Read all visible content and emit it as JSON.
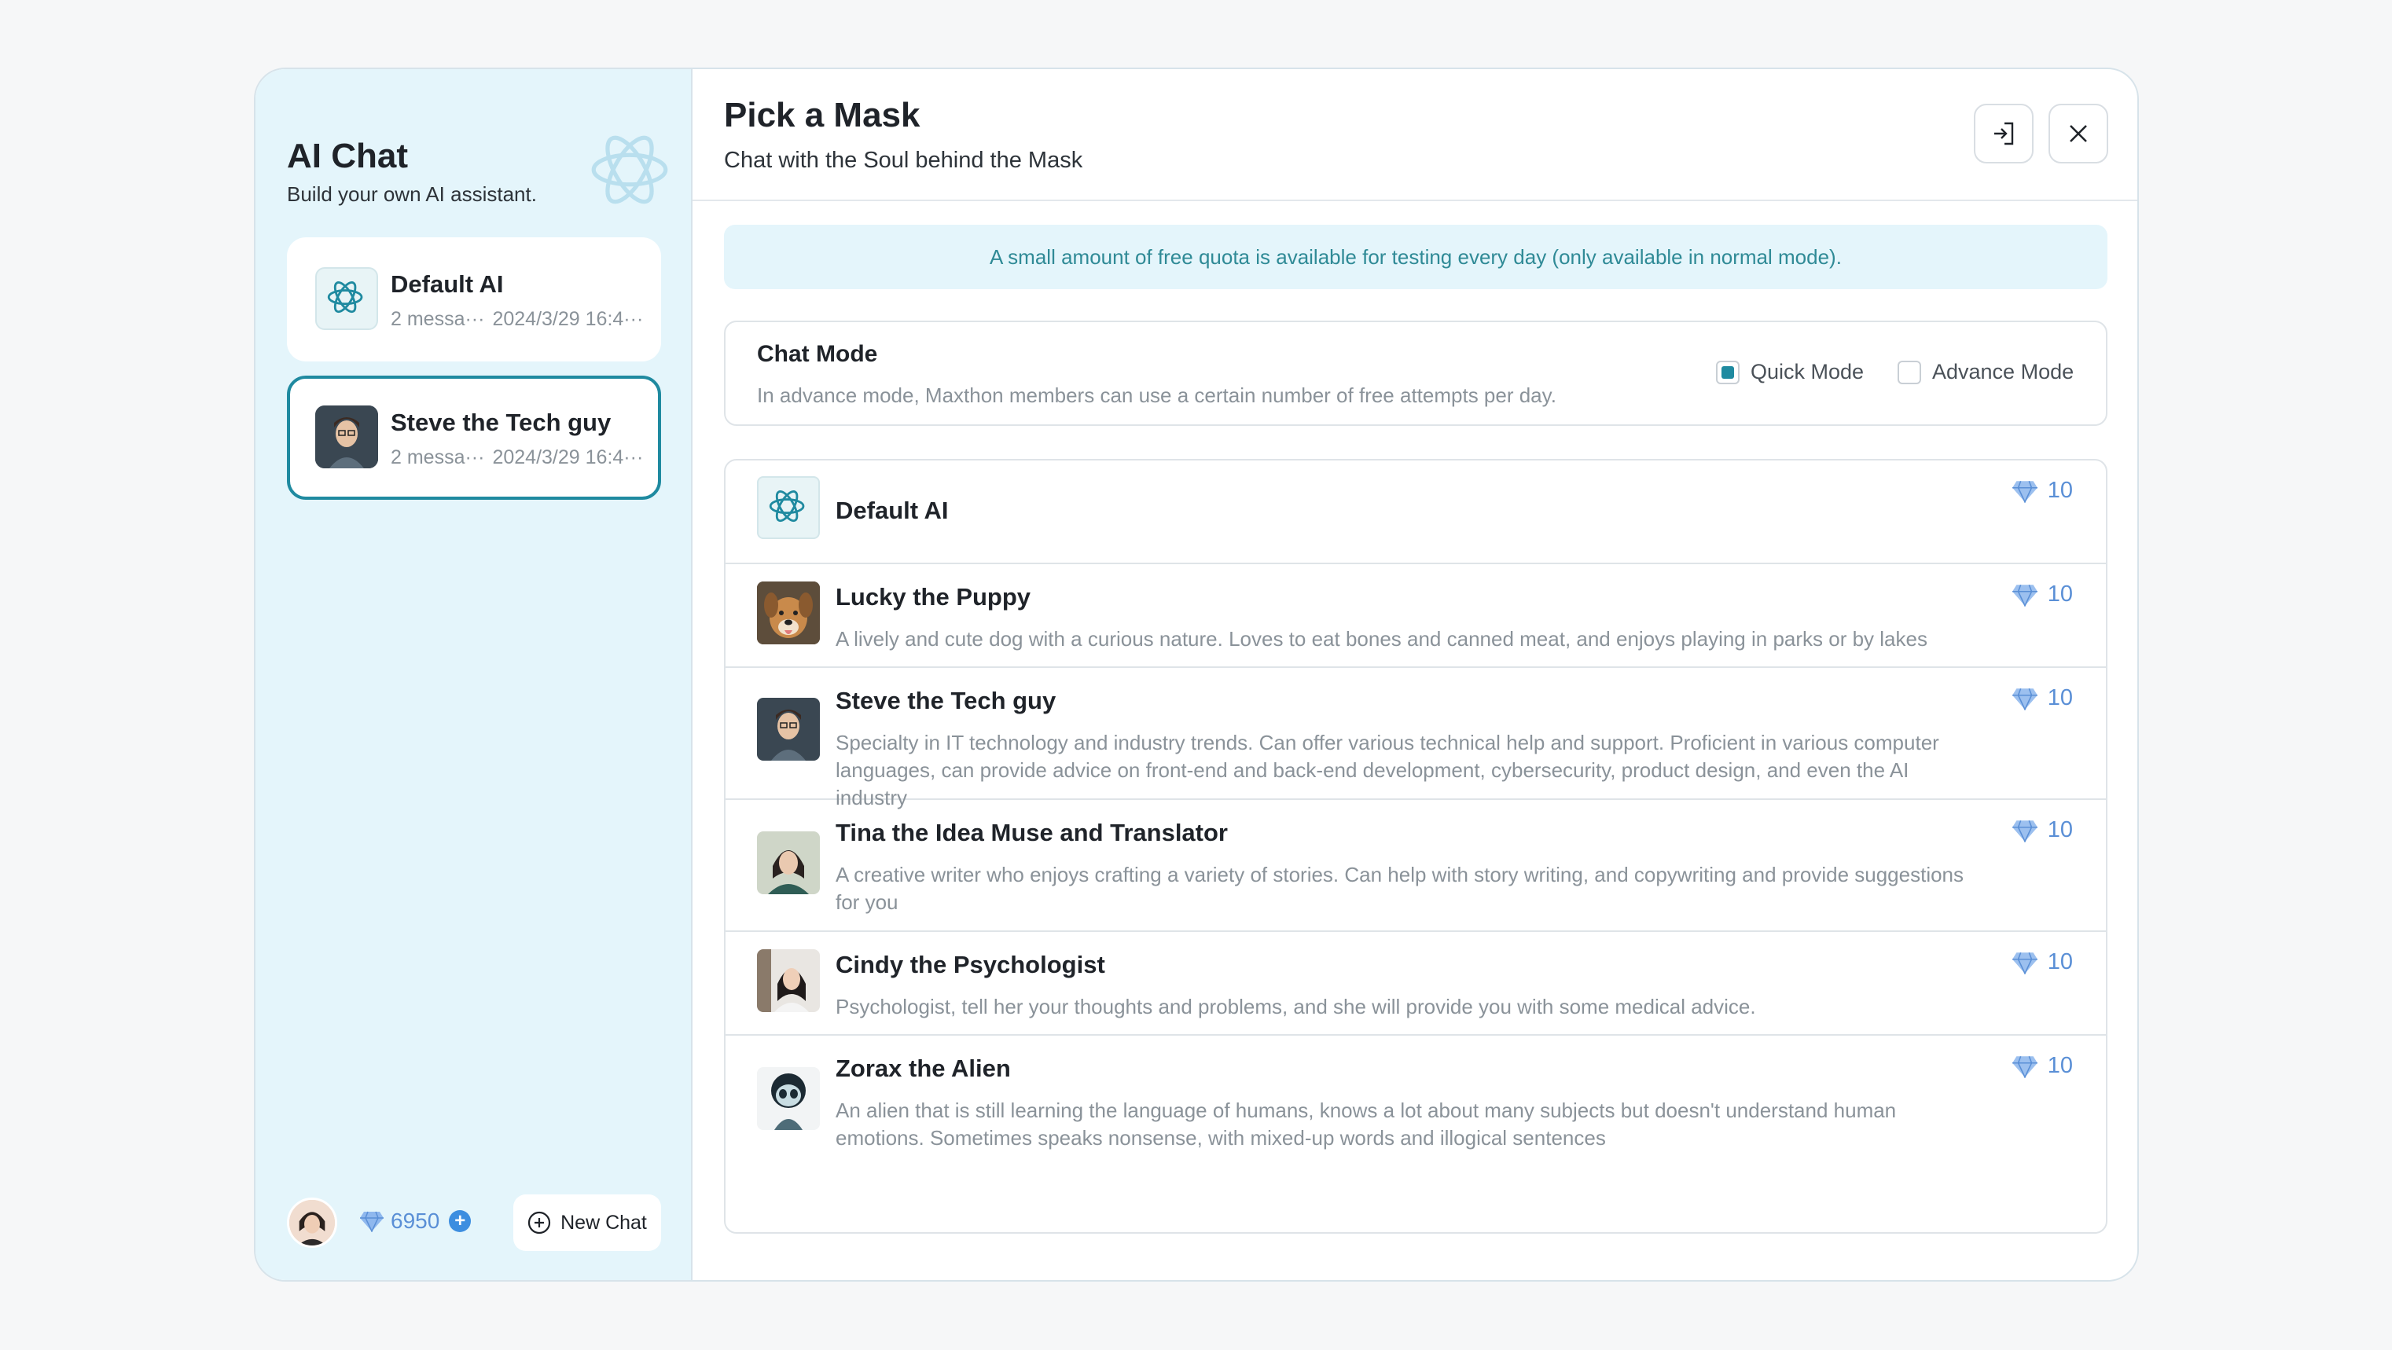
{
  "colors": {
    "accent": "#1f8aa0",
    "sidebar_bg": "#e4f5fb",
    "gem": "#5a8fd6"
  },
  "sidebar": {
    "title": "AI Chat",
    "subtitle": "Build your own AI assistant.",
    "chats": [
      {
        "name": "Default AI",
        "messages": "2 messa···",
        "time": "2024/3/29 16:4···",
        "active": false
      },
      {
        "name": "Steve the Tech guy",
        "messages": "2 messa···",
        "time": "2024/3/29 16:4···",
        "active": true
      }
    ],
    "footer": {
      "balance": "6950",
      "new_chat_label": "New Chat"
    }
  },
  "main": {
    "title": "Pick a Mask",
    "subtitle": "Chat with the Soul behind the Mask",
    "notice": "A small amount of free quota is available for testing every day (only available in normal mode).",
    "chat_mode": {
      "title": "Chat Mode",
      "description": "In advance mode, Maxthon members can use a certain number of free attempts per day.",
      "options": [
        {
          "label": "Quick Mode",
          "checked": true
        },
        {
          "label": "Advance Mode",
          "checked": false
        }
      ]
    },
    "masks": [
      {
        "name": "Default AI",
        "description": "",
        "cost": "10"
      },
      {
        "name": "Lucky the Puppy",
        "description": "A lively and cute dog with a curious nature. Loves to eat bones and canned meat, and enjoys playing in parks or by lakes",
        "cost": "10"
      },
      {
        "name": "Steve the Tech guy",
        "description": "Specialty in IT technology and industry trends. Can offer various technical help and support. Proficient in various computer languages, can provide advice on front-end and back-end development, cybersecurity, product design, and even the AI industry",
        "cost": "10"
      },
      {
        "name": "Tina the Idea Muse and Translator",
        "description": "A creative writer who enjoys crafting a variety of stories. Can help with story writing, and copywriting and provide suggestions for you",
        "cost": "10"
      },
      {
        "name": "Cindy the Psychologist",
        "description": "Psychologist, tell her your thoughts and problems, and she will provide you with some medical advice.",
        "cost": "10"
      },
      {
        "name": "Zorax the Alien",
        "description": "An alien that is still learning the language of humans, knows a lot about many subjects but doesn't understand human emotions. Sometimes speaks nonsense, with mixed-up words and illogical sentences",
        "cost": "10"
      }
    ]
  }
}
